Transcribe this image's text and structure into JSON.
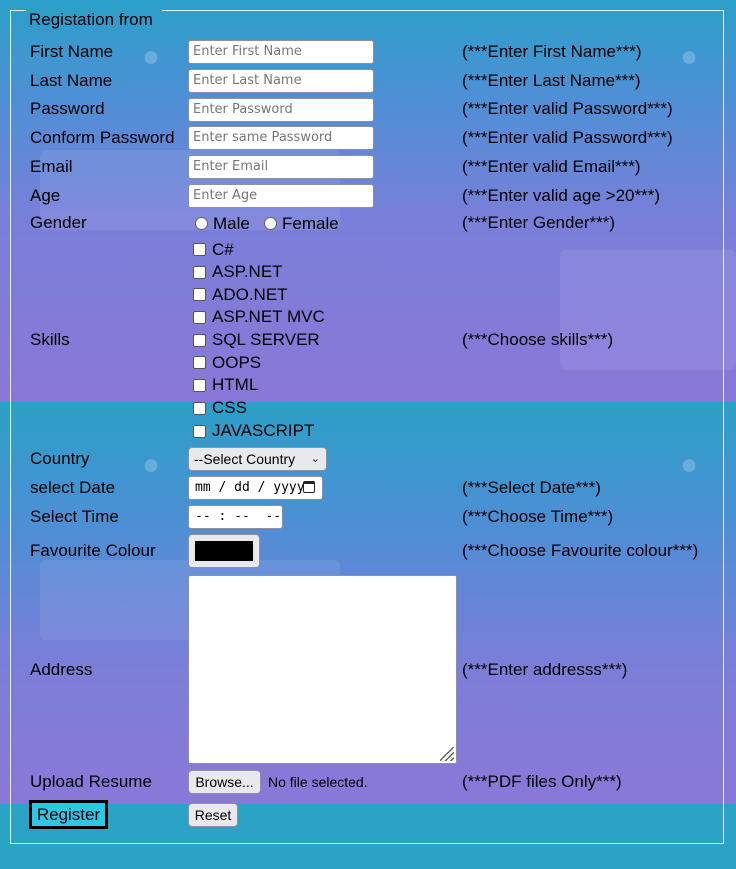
{
  "form": {
    "legend": "Registation from",
    "fields": [
      {
        "label": "First Name",
        "placeholder": "Enter First Name",
        "hint": "(***Enter First Name***)"
      },
      {
        "label": "Last Name",
        "placeholder": "Enter Last Name",
        "hint": "(***Enter Last Name***)"
      },
      {
        "label": "Password",
        "placeholder": "Enter Password",
        "hint": "(***Enter valid Password***)"
      },
      {
        "label": "Conform Password",
        "placeholder": "Enter same Password",
        "hint": "(***Enter valid Password***)"
      },
      {
        "label": "Email",
        "placeholder": "Enter Email",
        "hint": "(***Enter valid Email***)"
      },
      {
        "label": "Age",
        "placeholder": "Enter Age",
        "hint": "(***Enter valid age >20***)"
      }
    ],
    "gender": {
      "label": "Gender",
      "options": [
        "Male",
        "Female"
      ],
      "hint": "(***Enter Gender***)"
    },
    "skills": {
      "label": "Skills",
      "options": [
        "C#",
        "ASP.NET",
        "ADO.NET",
        "ASP.NET MVC",
        "SQL SERVER",
        "OOPS",
        "HTML",
        "CSS",
        "JAVASCRIPT"
      ],
      "hint": "(***Choose skills***)"
    },
    "country": {
      "label": "Country",
      "selected": "--Select Country"
    },
    "date": {
      "label": "select Date",
      "value": "mm / dd / yyyy",
      "hint": "(***Select Date***)"
    },
    "time": {
      "label": "Select Time",
      "value": "-- : --  --",
      "hint": "(***Choose Time***)"
    },
    "colour": {
      "label": "Favourite Colour",
      "value": "#000000",
      "hint": "(***Choose Favourite colour***)"
    },
    "address": {
      "label": "Address",
      "hint": "(***Enter addresss***)"
    },
    "resume": {
      "label": "Upload Resume",
      "button": "Browse...",
      "status": "No file selected.",
      "hint": "(***PDF files Only***)"
    },
    "buttons": {
      "register": "Register",
      "reset": "Reset"
    }
  },
  "icons": {
    "date_picker": "calendar-icon",
    "select": "chevron-down-icon",
    "resize": "resize-grip-icon"
  }
}
